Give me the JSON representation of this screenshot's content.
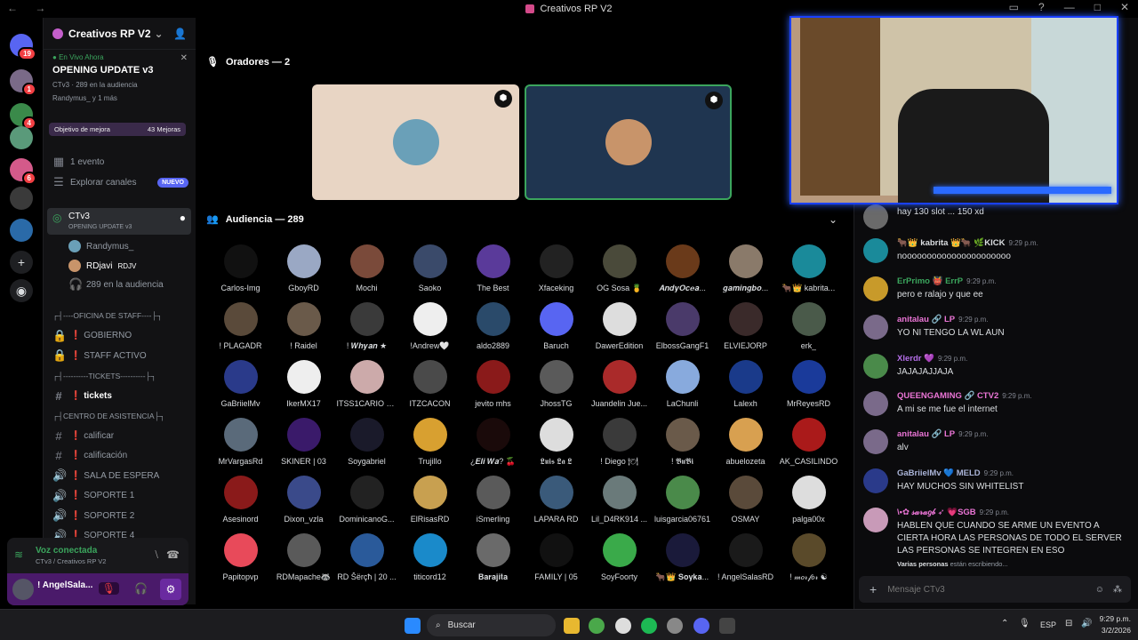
{
  "window": {
    "title": "Creativos RP V2"
  },
  "servers": [
    {
      "color": "#5865f2",
      "badge": "19"
    },
    {
      "color": "#7a6a88",
      "badge": "1"
    },
    {
      "color": "#3a8a4a",
      "badge": "4"
    },
    {
      "color": "#5a9a7a",
      "badge": ""
    },
    {
      "color": "#d45a8a",
      "badge": "6"
    },
    {
      "color": "#3a3a3a",
      "badge": ""
    },
    {
      "color": "#2a6aa8",
      "badge": ""
    }
  ],
  "sidebar": {
    "guild_name": "Creativos RP V2",
    "live_label": "En Vivo Ahora",
    "stage_title": "OPENING UPDATE v3",
    "stage_meta": "CTv3 · 289 en la audiencia",
    "stage_speakers": "Randymus_ y 1 más",
    "boost_goal": "Objetivo de mejora",
    "boost_count": "43 Mejoras",
    "events": "1 evento",
    "explore": "Explorar canales",
    "new_badge": "NUEVO",
    "stage_channel": "CTv3",
    "stage_channel_sub": "OPENING UPDATE v3",
    "speaker1": "Randymus_",
    "speaker2": "RDjavi",
    "speaker2_tag": "RDJV",
    "audience_count": "289 en la audiencia",
    "channels": [
      {
        "icon": "",
        "label": "┌┤----OFICINA DE STAFF----├┐",
        "cat": true
      },
      {
        "icon": "🔒",
        "label": "❗ GOBIERNO"
      },
      {
        "icon": "🔒",
        "label": "❗ STAFF ACTIVO"
      },
      {
        "icon": "",
        "label": "┌┤----------TICKETS----------├┐",
        "cat": true
      },
      {
        "icon": "#",
        "label": "❗ tickets",
        "active": true
      },
      {
        "icon": "",
        "label": "┌┤CENTRO DE ASISTENCIA├┐",
        "cat": true
      },
      {
        "icon": "#",
        "label": "❗ calificar"
      },
      {
        "icon": "#",
        "label": "❗ calificación"
      },
      {
        "icon": "🔊",
        "label": "❗ SALA DE ESPERA"
      },
      {
        "icon": "🔊",
        "label": "❗ SOPORTE 1"
      },
      {
        "icon": "🔊",
        "label": "❗ SOPORTE 2"
      },
      {
        "icon": "🔊",
        "label": "❗ SOPORTE 4"
      }
    ]
  },
  "voice": {
    "status": "Voz conectada",
    "location": "CTv3 / Creativos RP V2",
    "user": "! AngelSala..."
  },
  "stage": {
    "speakers_header": "Oradores — 2",
    "audience_header": "Audiencia — 289",
    "speakers": [
      {
        "color": "#e8d5c4",
        "avatar": "#6aa0b8"
      },
      {
        "color": "#1f3550",
        "avatar": "#c8946a"
      }
    ],
    "audience": [
      {
        "name": "Carlos-Img",
        "color": "#111"
      },
      {
        "name": "GboyRD",
        "color": "#9aa8c4"
      },
      {
        "name": "Mochi",
        "color": "#7a4a3a"
      },
      {
        "name": "Saoko",
        "color": "#3a4a6a"
      },
      {
        "name": "The Best",
        "color": "#5a3a9a"
      },
      {
        "name": "Xfaceking",
        "color": "#222"
      },
      {
        "name": "OG Sosa 🍍",
        "color": "#4a4a3a"
      },
      {
        "name": "𝑨𝒏𝒅𝒚𝑶𝒄𝒆𝒂...",
        "color": "#6a3a1a"
      },
      {
        "name": "𝒈𝒂𝒎𝒊𝒏𝒈𝒃𝒐...",
        "color": "#8a7a6a"
      },
      {
        "name": "🐂👑 kabrita...",
        "color": "#1a8a9a"
      },
      {
        "name": "! PLAGADR",
        "color": "#5a4a3a"
      },
      {
        "name": "! Raidel",
        "color": "#6a5a4a"
      },
      {
        "name": "! 𝑾𝒉𝒚𝒂𝒏 ★",
        "color": "#3a3a3a"
      },
      {
        "name": "!Andrew🤍",
        "color": "#eee"
      },
      {
        "name": "aldo2889",
        "color": "#2a4a6a"
      },
      {
        "name": "Baruch",
        "color": "#5865f2"
      },
      {
        "name": "DawerEdition",
        "color": "#ddd"
      },
      {
        "name": "ElbossGangF1",
        "color": "#4a3a6a"
      },
      {
        "name": "ELVIEJORP",
        "color": "#3a2a2a"
      },
      {
        "name": "erk_",
        "color": "#4a5a4a"
      },
      {
        "name": "GaBriielMv",
        "color": "#2a3a8a"
      },
      {
        "name": "IkerMX17",
        "color": "#eee"
      },
      {
        "name": "ITSS1CARIO O...",
        "color": "#caa"
      },
      {
        "name": "ITZCACON",
        "color": "#4a4a4a"
      },
      {
        "name": "jevito mhs",
        "color": "#8a1a1a"
      },
      {
        "name": "JhossTG",
        "color": "#5a5a5a"
      },
      {
        "name": "Juandelin Jue...",
        "color": "#aa2a2a"
      },
      {
        "name": "LaChunli",
        "color": "#8ad"
      },
      {
        "name": "Lalexh",
        "color": "#1a3a8a"
      },
      {
        "name": "MrReyesRD",
        "color": "#1a3a9a"
      },
      {
        "name": "MrVargasRd",
        "color": "#5a6a7a"
      },
      {
        "name": "SKINER | 03",
        "color": "#3a1a6a"
      },
      {
        "name": "Soygabriel",
        "color": "#1a1a2a"
      },
      {
        "name": "Trujillo",
        "color": "#d8a030"
      },
      {
        "name": "¿𝑬𝒍𝒊 𝑾𝒂? 🍒",
        "color": "#1a0a0a"
      },
      {
        "name": "𝕷𝖚𝖎𝖘 𝕷𝖆 𝕷",
        "color": "#ddd"
      },
      {
        "name": "! Diego 🍽",
        "color": "#3a3a3a"
      },
      {
        "name": "! 𝕭𝖚𝕭𝖎",
        "color": "#6a5a4a"
      },
      {
        "name": "abuelozeta",
        "color": "#d8a050"
      },
      {
        "name": "AK_CASILINDO",
        "color": "#aa1a1a"
      },
      {
        "name": "Asesinord",
        "color": "#8a1a1a"
      },
      {
        "name": "Dixon_vzla",
        "color": "#3a4a8a"
      },
      {
        "name": "DominicanoG...",
        "color": "#222"
      },
      {
        "name": "ElRisasRD",
        "color": "#c8a050"
      },
      {
        "name": "iSmerling",
        "color": "#5a5a5a"
      },
      {
        "name": "LAPARA RD",
        "color": "#3a5a7a"
      },
      {
        "name": "Lil_D4RK914 ...",
        "color": "#6a7a7a"
      },
      {
        "name": "luisgarcia06761",
        "color": "#4a8a4a"
      },
      {
        "name": "OSMAY",
        "color": "#5a4a3a"
      },
      {
        "name": "palga00x",
        "color": "#ddd"
      },
      {
        "name": "Papitopvp",
        "color": "#e84a5a"
      },
      {
        "name": "RDMapache🦝",
        "color": "#5a5a5a"
      },
      {
        "name": "RD Šërçħ | 20 ...",
        "color": "#2a5a9a"
      },
      {
        "name": "titicord12",
        "color": "#1a8aca"
      },
      {
        "name": "𝐁𝐚𝐫𝐚𝐣𝐢𝐭𝐚",
        "color": "#6a6a6a"
      },
      {
        "name": "FAMILY | 05",
        "color": "#111"
      },
      {
        "name": "SoyFoorty",
        "color": "#3aaa4a"
      },
      {
        "name": "🐂👑 𝐒𝐨𝐲𝐤𝐚...",
        "color": "#1a1a3a"
      },
      {
        "name": "! AngelSalasRD",
        "color": "#1a1a1a"
      },
      {
        "name": "! 𝓂𝑜𝓇𝒻𝑜𝓇 ☯",
        "color": "#5a4a2a"
      }
    ]
  },
  "chat": {
    "messages": [
      {
        "author": "",
        "time": "",
        "color": "#aaa",
        "avatar": "#6a6a6a",
        "text": "hay 130 slot ... 150 xd"
      },
      {
        "author": "🐂👑 kabrita 👑🐂 🌿KICK",
        "time": "9:29 p.m.",
        "color": "#dbdee1",
        "avatar": "#1a8a9a",
        "text": "noooooooooooooooooooooo"
      },
      {
        "author": "ErPrimo 👹 ErrP",
        "time": "9:29 p.m.",
        "color": "#3ba55d",
        "avatar": "#c89a2a",
        "text": "pero e ralajo  y que ee"
      },
      {
        "author": "anitalau 🔗 LP",
        "time": "9:29 p.m.",
        "color": "#eb75d6",
        "avatar": "#7a6a8a",
        "text": "YO NI TENGO LA WL AUN"
      },
      {
        "author": "Xlerdr 💜",
        "time": "9:29 p.m.",
        "color": "#b56ee8",
        "avatar": "#4a8a4a",
        "text": "JAJAJAJJAJA"
      },
      {
        "author": "QUEENGAMING 🔗 CTV2",
        "time": "9:29 p.m.",
        "color": "#eb75d6",
        "avatar": "#7a6a8a",
        "text": "A mi se me fue el internet"
      },
      {
        "author": "anitalau 🔗 LP",
        "time": "9:29 p.m.",
        "color": "#eb75d6",
        "avatar": "#7a6a8a",
        "text": "alv"
      },
      {
        "author": "GaBriielMv 💙 MELD",
        "time": "9:29 p.m.",
        "color": "#aab4d8",
        "avatar": "#2a3a8a",
        "text": "HAY MUCHOS SIN WHITELIST"
      },
      {
        "author": "\\•✿ 𝓈𝒶𝓇𝒶𝑔𝒷 ➶ 💗SGB",
        "time": "9:29 p.m.",
        "color": "#eb75d6",
        "avatar": "#c89ab8",
        "text": "HABLEN QUE CUANDO SE ARME UN EVENTO A CIERTA HORA LAS PERSONAS DE TODO EL SERVER LAS PERSONAS SE INTEGREN EN ESO"
      }
    ],
    "typing": "Varias personas están escribiendo...",
    "typing_bold": "Varias personas",
    "typing_rest": " están escribiendo...",
    "placeholder": "Mensaje CTv3"
  },
  "taskbar": {
    "search": "Buscar",
    "lang": "ESP",
    "time": "9:29 p.m.",
    "date": "3/2/2026"
  }
}
